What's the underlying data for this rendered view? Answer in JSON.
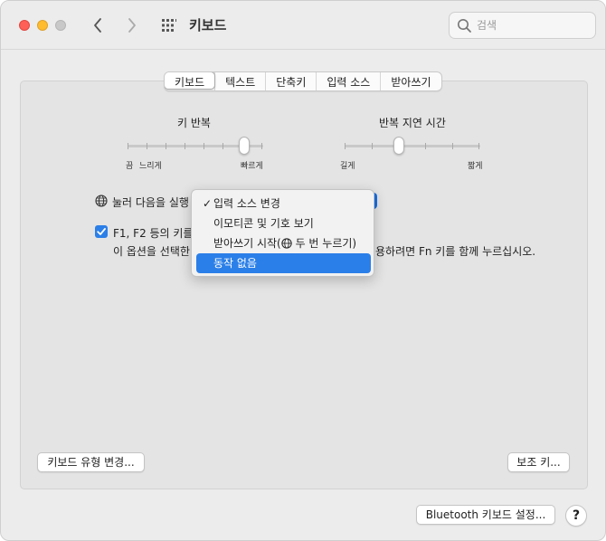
{
  "window": {
    "title": "키보드"
  },
  "search": {
    "placeholder": "검색"
  },
  "tabs": [
    {
      "label": "키보드",
      "active": true
    },
    {
      "label": "텍스트",
      "active": false
    },
    {
      "label": "단축키",
      "active": false
    },
    {
      "label": "입력 소스",
      "active": false
    },
    {
      "label": "받아쓰기",
      "active": false
    }
  ],
  "key_repeat": {
    "title": "키 반복",
    "label_off": "끔",
    "label_slow": "느리게",
    "label_fast": "빠르게",
    "level": 0.857
  },
  "repeat_delay": {
    "title": "반복 지연 시간",
    "label_long": "길게",
    "label_short": "짧게",
    "level": 0.4
  },
  "globe_key": {
    "label": "눌러 다음을 실행",
    "selected": "동작 없음"
  },
  "fn_option": {
    "checked": true,
    "line1": "F1, F2 등의 키를",
    "line2_start": "이 옵션을 선택한",
    "line2_end": "용하려면 Fn 키를 함께 누르십시오."
  },
  "menu": {
    "items": [
      {
        "label": "입력 소스 변경",
        "checked": true
      },
      {
        "label": "이모티콘 및 기호 보기",
        "checked": false
      },
      {
        "label_before": "받아쓰기 시작(",
        "label_after": " 두 번 누르기)",
        "checked": false
      },
      {
        "label": "동작 없음",
        "checked": false,
        "highlighted": true
      }
    ],
    "checkmark": "✓"
  },
  "buttons": {
    "change_keyboard_type": "키보드 유형 변경...",
    "assistant_keys": "보조 키...",
    "bluetooth_setup": "Bluetooth 키보드 설정...",
    "help": "?"
  },
  "colors": {
    "accent": "#2b7fe8",
    "traffic_red": "#fe5f57",
    "traffic_yellow": "#febc2e",
    "traffic_gray": "#c8c8c8"
  }
}
